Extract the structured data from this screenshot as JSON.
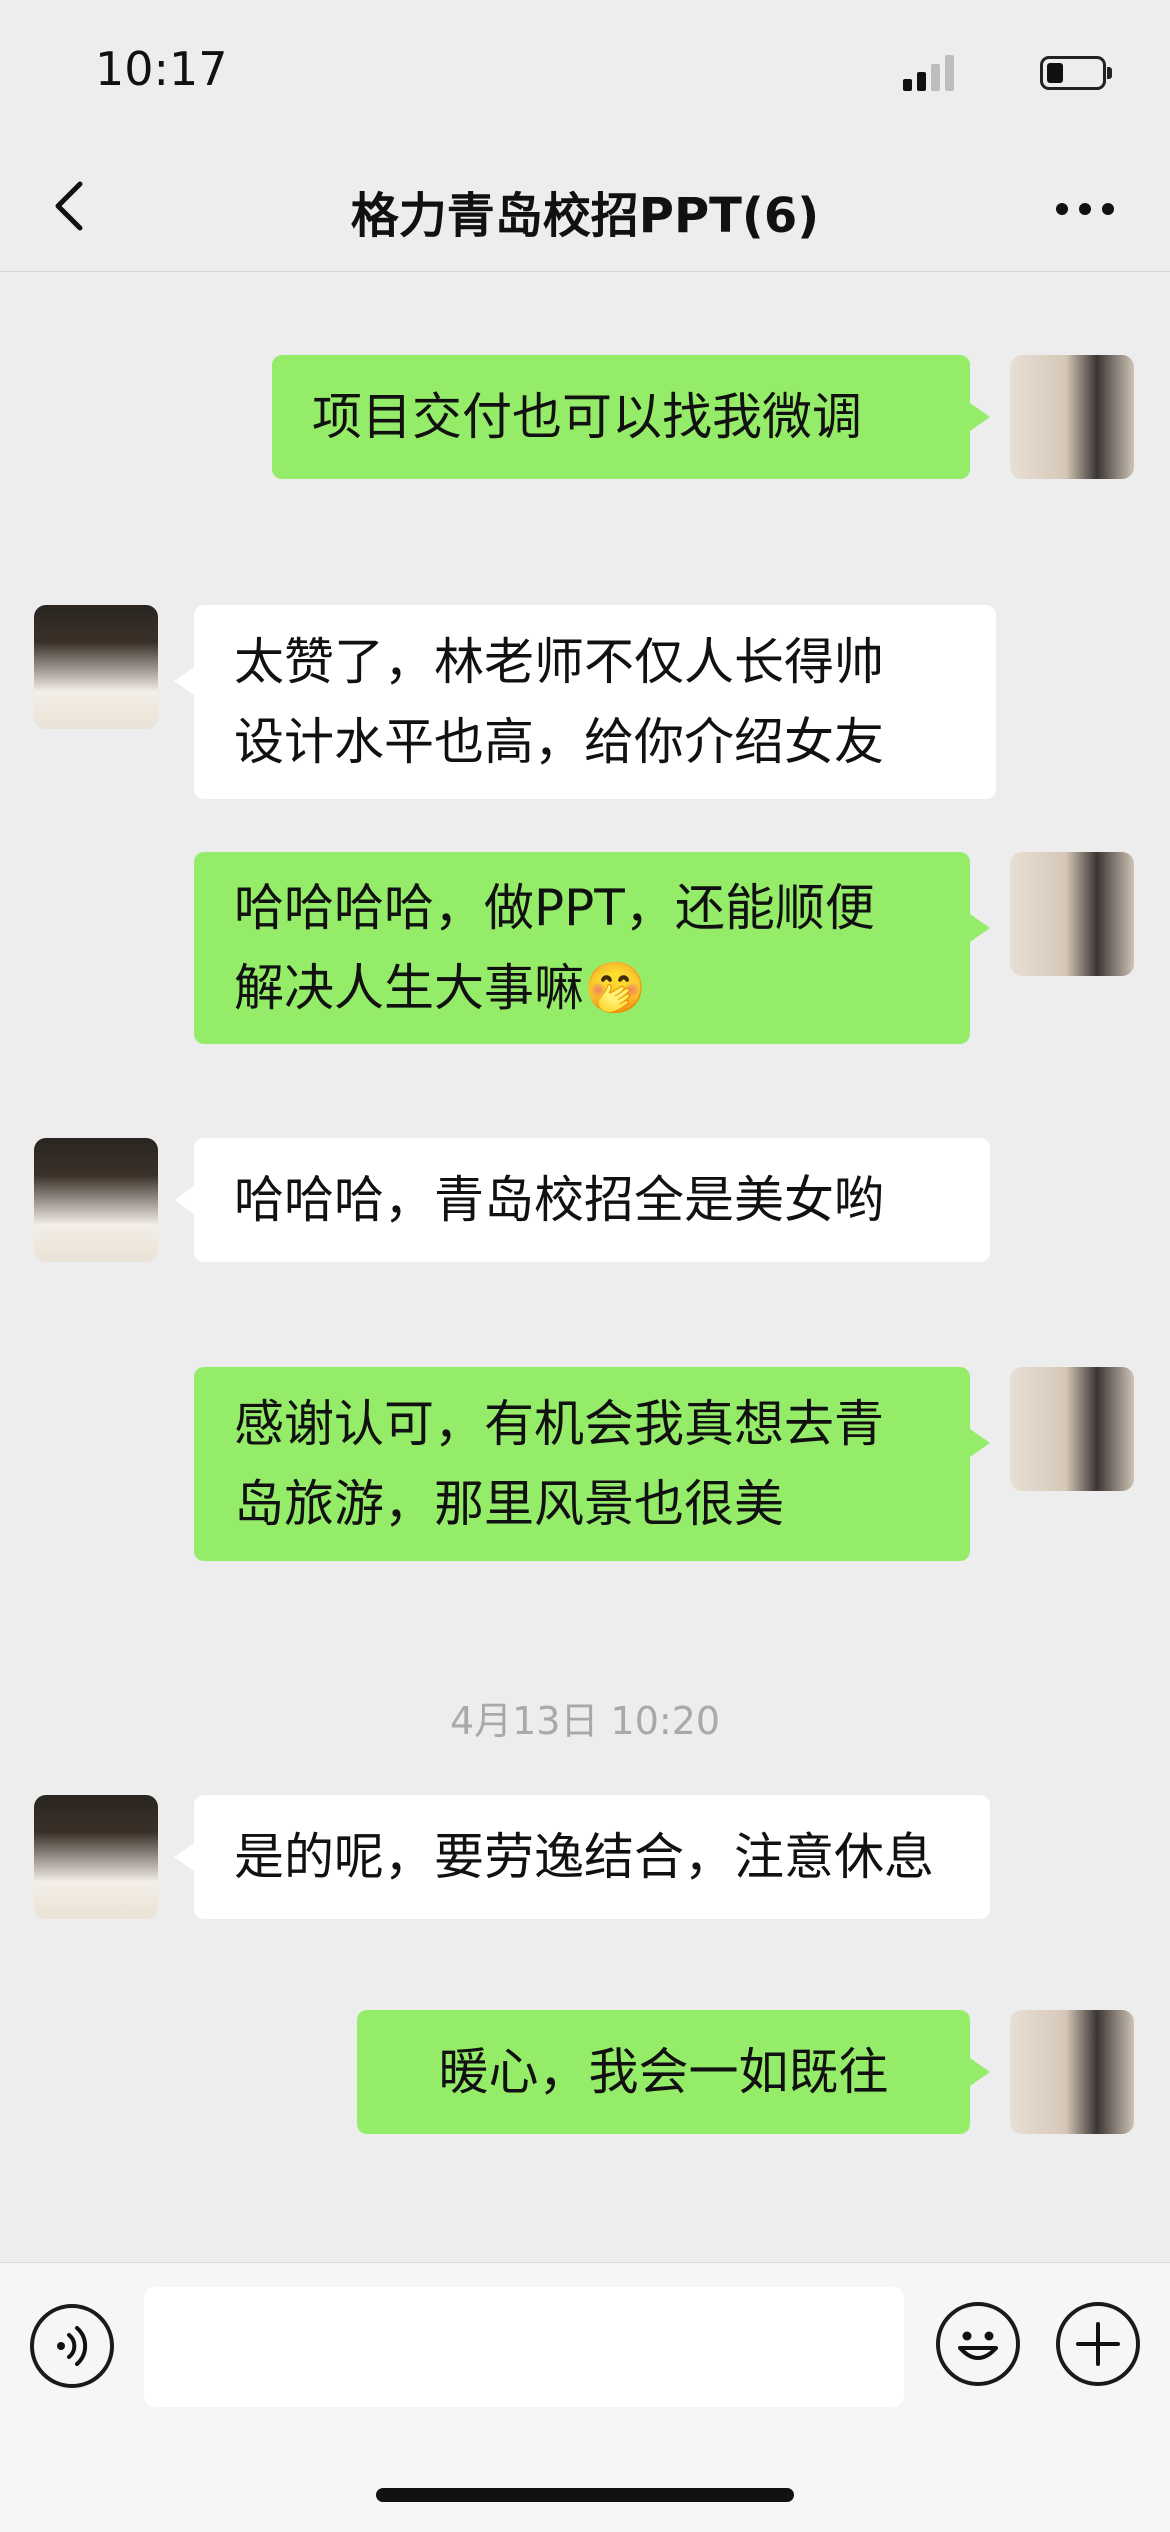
{
  "status_bar": {
    "time": "10:17",
    "signal_icon": "cellular-signal-icon",
    "battery_icon": "battery-icon",
    "battery_level": 0.3
  },
  "header": {
    "back_icon": "chevron-left-icon",
    "title": "格力青岛校招PPT(6)",
    "more_icon": "more-dots-icon"
  },
  "messages": [
    {
      "side": "mine",
      "lines": [
        "项目交付也可以找我微调"
      ]
    },
    {
      "side": "other",
      "lines": [
        "太赞了，林老师不仅人长得帅",
        "设计水平也高，给你介绍女友"
      ]
    },
    {
      "side": "mine",
      "lines": [
        "哈哈哈哈，做PPT，还能顺便",
        "解决人生大事嘛🤭"
      ]
    },
    {
      "side": "other",
      "lines": [
        "哈哈哈，青岛校招全是美女哟"
      ]
    },
    {
      "side": "mine",
      "lines": [
        "感谢认可，有机会我真想去青",
        "岛旅游，那里风景也很美"
      ]
    },
    {
      "side": "other",
      "lines": [
        "是的呢，要劳逸结合，注意休息"
      ]
    },
    {
      "side": "mine",
      "lines": [
        "暖心，我会一如既往"
      ]
    }
  ],
  "timestamp": "4月13日 10:20",
  "input_bar": {
    "voice_icon": "voice-icon",
    "input_value": "",
    "emoji_icon": "emoji-icon",
    "add_icon": "plus-icon"
  },
  "colors": {
    "background": "#ededed",
    "my_bubble": "#95ec69",
    "other_bubble": "#ffffff",
    "timestamp_text": "#a9a9a9"
  }
}
